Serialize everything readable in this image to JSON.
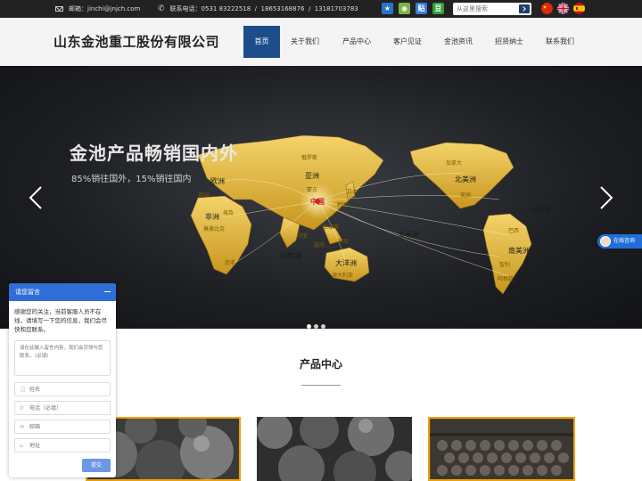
{
  "topbar": {
    "email_label": "邮箱：",
    "email": "jinchi@jnjch.com",
    "phone_label": "联系电话：",
    "phone1": "0531 83222518",
    "sep": "/",
    "phone2": "18653168876",
    "phone3": "13181703783",
    "social": [
      {
        "icon": "qzone-icon",
        "glyph": "★",
        "color": "#2a74c9"
      },
      {
        "icon": "kaixin-icon",
        "glyph": "◉",
        "color": "#7bb24a"
      },
      {
        "icon": "tieba-icon",
        "glyph": "贴",
        "color": "#3b7be0"
      },
      {
        "icon": "douban-icon",
        "glyph": "豆",
        "color": "#2f9f3a"
      }
    ],
    "search_placeholder": "从这里搜索",
    "languages": [
      "chinese-flag-icon",
      "uk-flag-icon",
      "spanish-flag-icon"
    ]
  },
  "header": {
    "title": "山东金池重工股份有限公司",
    "nav": [
      "首页",
      "关于我们",
      "产品中心",
      "客户见证",
      "金池资讯",
      "招贤纳士",
      "联系我们"
    ],
    "active_index": 0
  },
  "banner": {
    "headline": "金池产品畅销国内外",
    "subline": "85%销往国外，15%销往国内",
    "map_labels": {
      "russia": "俄罗斯",
      "asia": "亚洲",
      "mongolia": "蒙古",
      "japan": "日本",
      "korea": "韩国",
      "china": "中国",
      "philippines": "菲律宾",
      "vietnam": "越南",
      "europe": "欧洲",
      "britain": "英国",
      "egypt": "埃及",
      "africa": "非洲",
      "south_africa": "南非",
      "indian_ocean": "印度洋",
      "australia": "大洋洲",
      "australia_country": "澳大利亚",
      "pacific": "太平洋",
      "canada": "加拿大",
      "north_america": "北美洲",
      "usa": "美国",
      "atlantic": "大西洋",
      "brazil": "巴西",
      "south_america": "南美洲",
      "chile": "智利",
      "argentina": "阿根廷",
      "mozambique": "莫桑比克",
      "india": "印度",
      "indonesia": "印尼"
    },
    "slide_count": 3,
    "active_slide": 0
  },
  "service_tab": {
    "label": "在线咨询"
  },
  "products": {
    "title": "产品中心"
  },
  "widget": {
    "title": "请您留言",
    "description": "感谢您的关注，当前客服人员不在线，请填写一下您的信息，我们会尽快和您联系。",
    "message_placeholder": "请在此输入留言内容，我们会尽快与您联系。（必填）",
    "name_placeholder": "姓名",
    "phone_placeholder": "电话（必填）",
    "email_placeholder": "邮箱",
    "address_placeholder": "地址",
    "submit_label": "提交"
  }
}
